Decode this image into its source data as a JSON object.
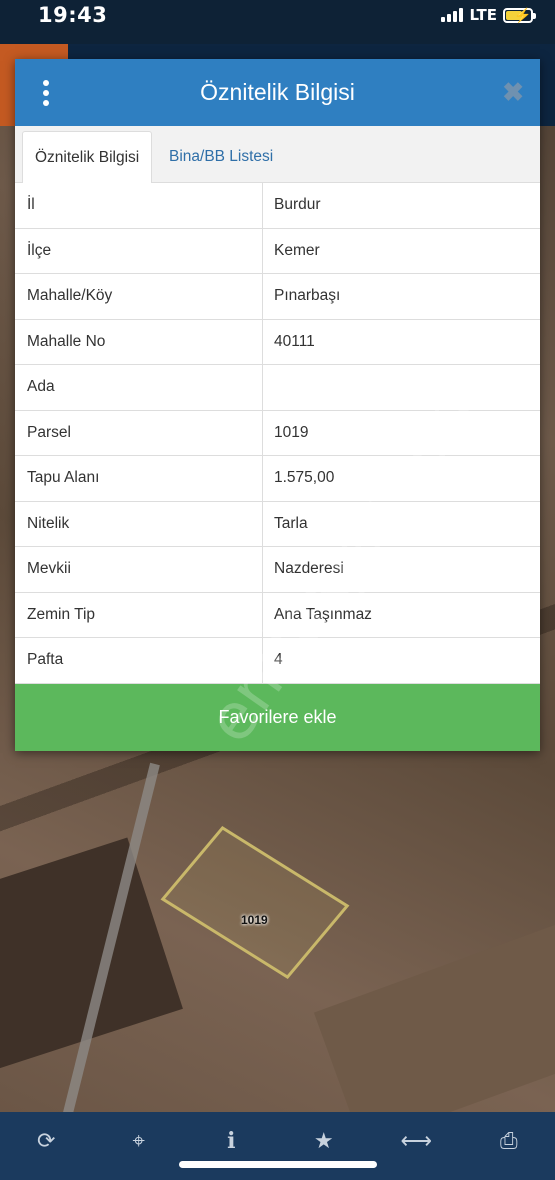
{
  "status": {
    "time": "19:43",
    "network": "LTE"
  },
  "dialog": {
    "title": "Öznitelik Bilgisi",
    "tabs": [
      "Öznitelik Bilgisi",
      "Bina/BB Listesi"
    ],
    "rows": [
      {
        "key": "İl",
        "value": "Burdur"
      },
      {
        "key": "İlçe",
        "value": "Kemer"
      },
      {
        "key": "Mahalle/Köy",
        "value": "Pınarbaşı"
      },
      {
        "key": "Mahalle No",
        "value": "40111"
      },
      {
        "key": "Ada",
        "value": ""
      },
      {
        "key": "Parsel",
        "value": "1019"
      },
      {
        "key": "Tapu Alanı",
        "value": "1.575,00"
      },
      {
        "key": "Nitelik",
        "value": "Tarla"
      },
      {
        "key": "Mevkii",
        "value": "Nazderesi"
      },
      {
        "key": "Zemin Tip",
        "value": "Ana Taşınmaz"
      },
      {
        "key": "Pafta",
        "value": "4"
      }
    ],
    "favorite_label": "Favorilere ekle"
  },
  "map": {
    "parcel_label": "1019",
    "watermark": "emlakjet.com"
  },
  "toolbar": {
    "icons": [
      "refresh-icon",
      "locate-icon",
      "info-icon",
      "star-icon",
      "measure-icon",
      "print-icon"
    ]
  },
  "colors": {
    "header": "#2f7fc1",
    "button": "#5cb85c",
    "toolbar": "#1b3a5e"
  }
}
